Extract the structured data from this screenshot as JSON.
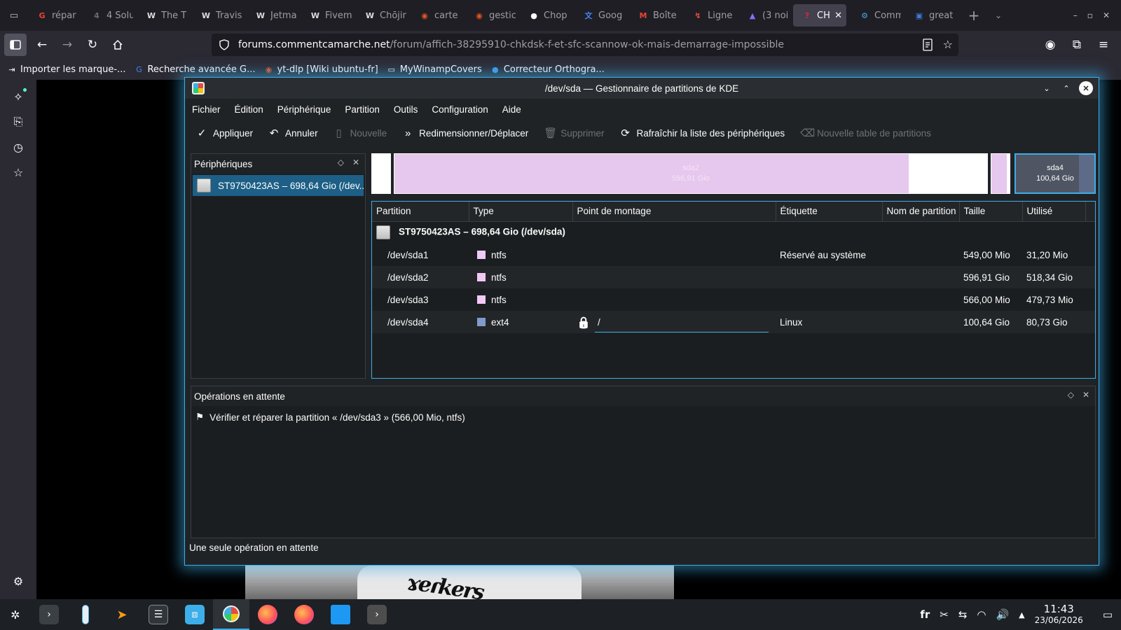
{
  "browser": {
    "tabs": [
      {
        "label": "répar",
        "icon": "google-icon",
        "color": "#ea4335",
        "glyph": "G"
      },
      {
        "label": "4 Solu",
        "icon": "site-icon",
        "color": "#6b6b6b",
        "glyph": "4"
      },
      {
        "label": "The T",
        "icon": "wikipedia-icon",
        "color": "#dddddd",
        "glyph": "W"
      },
      {
        "label": "Travis",
        "icon": "wikipedia-icon",
        "color": "#dddddd",
        "glyph": "W"
      },
      {
        "label": "Jetma",
        "icon": "wikipedia-icon",
        "color": "#dddddd",
        "glyph": "W"
      },
      {
        "label": "Fiveme",
        "icon": "wikipedia-icon",
        "color": "#dddddd",
        "glyph": "W"
      },
      {
        "label": "Chōjin",
        "icon": "wikipedia-icon",
        "color": "#dddddd",
        "glyph": "W"
      },
      {
        "label": "carte",
        "icon": "ubuntu-icon",
        "color": "#e95420",
        "glyph": "◉"
      },
      {
        "label": "gestic",
        "icon": "ubuntu-icon",
        "color": "#e95420",
        "glyph": "◉"
      },
      {
        "label": "Chop",
        "icon": "github-icon",
        "color": "#ffffff",
        "glyph": "●"
      },
      {
        "label": "Goog",
        "icon": "google-translate-icon",
        "color": "#4285f4",
        "glyph": "文"
      },
      {
        "label": "Boîte",
        "icon": "gmail-icon",
        "color": "#ea4335",
        "glyph": "M"
      },
      {
        "label": "Ligne",
        "icon": "site-icon",
        "color": "#e94e3c",
        "glyph": "↯"
      },
      {
        "label": "(3 noi",
        "icon": "proton-icon",
        "color": "#8a6cff",
        "glyph": "▲"
      },
      {
        "label": "CHK",
        "icon": "ccm-icon",
        "color": "#e3233c",
        "glyph": "?",
        "active": true
      },
      {
        "label": "Comm",
        "icon": "kde-icon",
        "color": "#3daee9",
        "glyph": "⚙"
      },
      {
        "label": "great",
        "icon": "site-icon",
        "color": "#3d7dd8",
        "glyph": "▣"
      }
    ],
    "url_host": "forums.commentcamarche.net",
    "url_path": "/forum/affich-38295910-chkdsk-f-et-sfc-scannow-ok-mais-demarrage-impossible",
    "bookmarks": [
      {
        "label": "Importer les marque-...",
        "icon": "import-icon"
      },
      {
        "label": "Recherche avancée G...",
        "icon": "google-icon"
      },
      {
        "label": "yt-dlp [Wiki ubuntu-fr]",
        "icon": "ubuntu-icon"
      },
      {
        "label": "MyWinampCovers",
        "icon": "folder-icon"
      },
      {
        "label": "Correcteur Orthogra...",
        "icon": "globe-icon"
      }
    ]
  },
  "kde": {
    "title": "/dev/sda — Gestionnaire de partitions de KDE",
    "menu": [
      "Fichier",
      "Édition",
      "Périphérique",
      "Partition",
      "Outils",
      "Configuration",
      "Aide"
    ],
    "toolbar": {
      "apply": "Appliquer",
      "undo": "Annuler",
      "new": "Nouvelle",
      "resize": "Redimensionner/Déplacer",
      "delete": "Supprimer",
      "refresh": "Rafraîchir la liste des périphériques",
      "new_table": "Nouvelle table de partitions"
    },
    "devices_panel": {
      "title": "Périphériques",
      "device": "ST9750423AS – 698,64 Gio (/dev..."
    },
    "partition_bar": {
      "sda2_name": "sda2",
      "sda2_size": "596,91 Gio",
      "sda4_name": "sda4",
      "sda4_size": "100,64 Gio",
      "segments": [
        {
          "name": "sda1",
          "type": "ntfs",
          "size_gib": 0.536,
          "used_fraction": 0.057
        },
        {
          "name": "sda2",
          "type": "ntfs",
          "size_gib": 596.91,
          "used_fraction": 0.868
        },
        {
          "name": "sda3",
          "type": "ntfs",
          "size_gib": 0.553,
          "used_fraction": 0.847
        },
        {
          "name": "sda4",
          "type": "ext4",
          "size_gib": 100.64,
          "used_fraction": 0.802
        }
      ]
    },
    "table": {
      "headers": {
        "partition": "Partition",
        "type": "Type",
        "mount": "Point de montage",
        "label": "Étiquette",
        "name": "Nom de partition",
        "size": "Taille",
        "used": "Utilisé"
      },
      "disk_row": "ST9750423AS – 698,64 Gio (/dev/sda)",
      "rows": [
        {
          "partition": "/dev/sda1",
          "type": "ntfs",
          "color": "#f2c9f5",
          "mount": "",
          "label": "Réservé au système",
          "name": "",
          "size": "549,00 Mio",
          "used": "31,20 Mio"
        },
        {
          "partition": "/dev/sda2",
          "type": "ntfs",
          "color": "#f2c9f5",
          "mount": "",
          "label": "",
          "name": "",
          "size": "596,91 Gio",
          "used": "518,34 Gio"
        },
        {
          "partition": "/dev/sda3",
          "type": "ntfs",
          "color": "#f2c9f5",
          "mount": "",
          "label": "",
          "name": "",
          "size": "566,00 Mio",
          "used": "479,73 Mio"
        },
        {
          "partition": "/dev/sda4",
          "type": "ext4",
          "color": "#7f9acb",
          "mount": "/",
          "label": "Linux",
          "name": "",
          "size": "100,64 Gio",
          "used": "80,73 Gio",
          "locked": true
        }
      ]
    },
    "ops_panel": {
      "title": "Opérations en attente",
      "item": "Vérifier et réparer la partition « /dev/sda3 » (566,00 Mio, ntfs)"
    },
    "status": "Une seule opération en attente"
  },
  "taskbar": {
    "lang": "fr",
    "time": "11:43",
    "date": "23/06/2026"
  }
}
